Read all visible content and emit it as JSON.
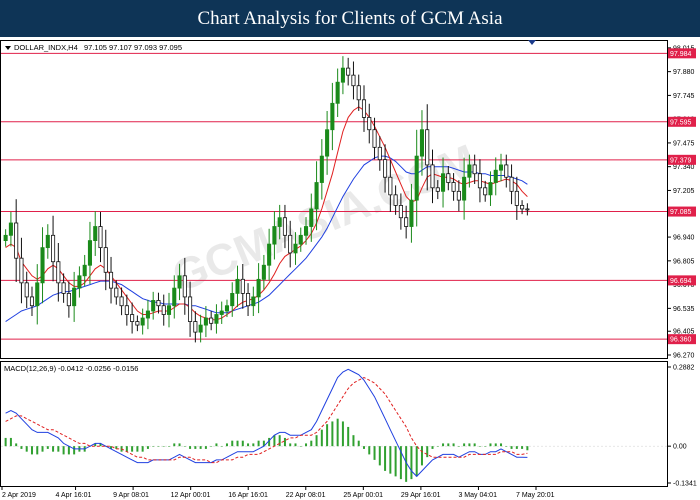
{
  "banner": {
    "title": "Chart Analysis for Clients of GCM Asia"
  },
  "watermark": "GCMASIA.COM",
  "colors": {
    "bull": "#1a8a1a",
    "bear": "#111111",
    "ma_fast": "#e02020",
    "ma_slow": "#2040e0",
    "level": "#e0204a",
    "macd_hist": "#30a030",
    "macd_signal": "#e02020",
    "macd_line": "#2040e0"
  },
  "chart_data": [
    {
      "type": "candlestick",
      "title": "DOLLAR_INDX,H4  97.105 97.107 97.093 97.095",
      "symbol": "DOLLAR_INDX,H4",
      "ohlc_readout": "97.105 97.107 97.093 97.095",
      "ylim": [
        96.27,
        98.02
      ],
      "y_ticks": [
        "98.015",
        "97.880",
        "97.745",
        "97.610",
        "97.475",
        "97.340",
        "97.205",
        "97.070",
        "96.940",
        "96.805",
        "96.670",
        "96.535",
        "96.405",
        "96.270"
      ],
      "x_ticks": [
        "2 Apr 2019",
        "4 Apr 16:01",
        "9 Apr 08:01",
        "12 Apr 00:01",
        "16 Apr 16:01",
        "22 Apr 08:01",
        "25 Apr 00:01",
        "29 Apr 16:01",
        "3 May 04:01",
        "7 May 20:01"
      ],
      "levels": [
        {
          "label": "97.984",
          "value": 97.984
        },
        {
          "label": "97.595",
          "value": 97.595
        },
        {
          "label": "97.379",
          "value": 97.379
        },
        {
          "label": "97.085",
          "value": 97.085
        },
        {
          "label": "96.694",
          "value": 96.694
        },
        {
          "label": "96.360",
          "value": 96.36
        }
      ],
      "series": [
        {
          "kind": "close",
          "values": [
            96.95,
            97.02,
            96.82,
            96.68,
            96.6,
            96.55,
            96.68,
            96.88,
            96.95,
            96.8,
            96.68,
            96.62,
            96.55,
            96.65,
            96.72,
            96.78,
            96.92,
            97.0,
            96.88,
            96.74,
            96.65,
            96.6,
            96.55,
            96.5,
            96.46,
            96.44,
            96.48,
            96.52,
            96.58,
            96.55,
            96.5,
            96.55,
            96.65,
            96.72,
            96.6,
            96.46,
            96.4,
            96.44,
            96.48,
            96.45,
            96.5,
            96.52,
            96.55,
            96.62,
            96.7,
            96.62,
            96.55,
            96.6,
            96.7,
            96.78,
            96.9,
            97.0,
            97.05,
            96.95,
            96.85,
            96.9,
            96.95,
            97.0,
            97.1,
            97.25,
            97.4,
            97.55,
            97.7,
            97.82,
            97.9,
            97.86,
            97.8,
            97.72,
            97.62,
            97.55,
            97.45,
            97.38,
            97.28,
            97.18,
            97.12,
            97.05,
            97.0,
            97.15,
            97.4,
            97.55,
            97.35,
            97.22,
            97.2,
            97.3,
            97.25,
            97.2,
            97.15,
            97.28,
            97.35,
            97.3,
            97.22,
            97.18,
            97.25,
            97.32,
            97.35,
            97.28,
            97.2,
            97.12,
            97.1,
            97.095
          ]
        },
        {
          "kind": "ma_fast",
          "name": "",
          "values": [
            96.88,
            96.9,
            96.88,
            96.8,
            96.76,
            96.72,
            96.7,
            96.72,
            96.76,
            96.78,
            96.76,
            96.72,
            96.68,
            96.66,
            96.66,
            96.68,
            96.72,
            96.76,
            96.78,
            96.76,
            96.72,
            96.68,
            96.64,
            96.6,
            96.56,
            96.52,
            96.5,
            96.5,
            96.51,
            96.52,
            96.52,
            96.52,
            96.54,
            96.56,
            96.56,
            96.54,
            96.51,
            96.49,
            96.48,
            96.47,
            96.47,
            96.48,
            96.5,
            96.52,
            96.55,
            96.57,
            96.58,
            96.59,
            96.61,
            96.64,
            96.68,
            96.73,
            96.79,
            96.83,
            96.85,
            96.87,
            96.89,
            96.92,
            96.96,
            97.02,
            97.1,
            97.2,
            97.3,
            97.42,
            97.54,
            97.62,
            97.66,
            97.68,
            97.66,
            97.62,
            97.57,
            97.51,
            97.45,
            97.38,
            97.31,
            97.24,
            97.17,
            97.14,
            97.15,
            97.22,
            97.28,
            97.3,
            97.29,
            97.28,
            97.28,
            97.27,
            97.25,
            97.24,
            97.25,
            97.26,
            97.26,
            97.25,
            97.24,
            97.25,
            97.26,
            97.27,
            97.26,
            97.24,
            97.2,
            97.17
          ]
        },
        {
          "kind": "ma_slow",
          "name": "",
          "values": [
            96.46,
            96.48,
            96.5,
            96.52,
            96.53,
            96.54,
            96.55,
            96.57,
            96.59,
            96.61,
            96.62,
            96.63,
            96.63,
            96.64,
            96.65,
            96.66,
            96.67,
            96.68,
            96.69,
            96.69,
            96.69,
            96.68,
            96.67,
            96.65,
            96.63,
            96.61,
            96.59,
            96.58,
            96.57,
            96.57,
            96.56,
            96.56,
            96.56,
            96.56,
            96.56,
            96.55,
            96.55,
            96.54,
            96.53,
            96.52,
            96.51,
            96.51,
            96.51,
            96.52,
            96.53,
            96.54,
            96.55,
            96.56,
            96.57,
            96.59,
            96.61,
            96.64,
            96.67,
            96.7,
            96.73,
            96.76,
            96.79,
            96.82,
            96.86,
            96.9,
            96.94,
            96.99,
            97.05,
            97.11,
            97.17,
            97.22,
            97.27,
            97.31,
            97.35,
            97.37,
            97.39,
            97.4,
            97.4,
            97.39,
            97.37,
            97.34,
            97.31,
            97.3,
            97.3,
            97.32,
            97.34,
            97.34,
            97.34,
            97.34,
            97.34,
            97.33,
            97.32,
            97.31,
            97.31,
            97.31,
            97.3,
            97.3,
            97.29,
            97.29,
            97.29,
            97.29,
            97.28,
            97.27,
            97.26,
            97.24
          ]
        }
      ]
    },
    {
      "type": "bar",
      "title": "MACD(12,26,9) -0.0412 -0.0256 -0.0156",
      "indicator": "MACD(12,26,9)",
      "readout": "-0.0412 -0.0256 -0.0156",
      "ylim": [
        -0.1341,
        0.2882
      ],
      "y_ticks": [
        "0.2882",
        "0.00",
        "-0.1341"
      ],
      "series": [
        {
          "kind": "macd_line",
          "name": "",
          "values": [
            0.12,
            0.13,
            0.12,
            0.1,
            0.08,
            0.06,
            0.05,
            0.05,
            0.05,
            0.04,
            0.03,
            0.01,
            0.0,
            -0.01,
            -0.01,
            -0.01,
            0.0,
            0.01,
            0.01,
            0.0,
            -0.01,
            -0.02,
            -0.03,
            -0.04,
            -0.05,
            -0.06,
            -0.06,
            -0.06,
            -0.05,
            -0.05,
            -0.05,
            -0.05,
            -0.04,
            -0.03,
            -0.04,
            -0.05,
            -0.06,
            -0.06,
            -0.06,
            -0.06,
            -0.05,
            -0.05,
            -0.04,
            -0.03,
            -0.02,
            -0.02,
            -0.02,
            -0.02,
            -0.01,
            0.0,
            0.02,
            0.04,
            0.05,
            0.05,
            0.04,
            0.04,
            0.04,
            0.05,
            0.06,
            0.09,
            0.13,
            0.17,
            0.21,
            0.25,
            0.27,
            0.28,
            0.27,
            0.26,
            0.24,
            0.21,
            0.18,
            0.14,
            0.1,
            0.06,
            0.02,
            -0.02,
            -0.06,
            -0.09,
            -0.11,
            -0.09,
            -0.07,
            -0.05,
            -0.04,
            -0.03,
            -0.03,
            -0.03,
            -0.04,
            -0.03,
            -0.02,
            -0.02,
            -0.03,
            -0.03,
            -0.02,
            -0.02,
            -0.01,
            -0.02,
            -0.03,
            -0.04,
            -0.04,
            -0.041
          ]
        },
        {
          "kind": "macd_signal",
          "name": "",
          "values": [
            0.09,
            0.1,
            0.11,
            0.11,
            0.1,
            0.09,
            0.08,
            0.07,
            0.06,
            0.06,
            0.05,
            0.04,
            0.03,
            0.02,
            0.01,
            0.01,
            0.0,
            0.0,
            0.0,
            0.0,
            0.0,
            -0.01,
            -0.01,
            -0.02,
            -0.03,
            -0.04,
            -0.04,
            -0.05,
            -0.05,
            -0.05,
            -0.05,
            -0.05,
            -0.05,
            -0.04,
            -0.04,
            -0.04,
            -0.05,
            -0.05,
            -0.05,
            -0.06,
            -0.06,
            -0.05,
            -0.05,
            -0.05,
            -0.04,
            -0.04,
            -0.03,
            -0.03,
            -0.03,
            -0.02,
            -0.01,
            0.0,
            0.01,
            0.02,
            0.03,
            0.03,
            0.04,
            0.04,
            0.04,
            0.05,
            0.07,
            0.09,
            0.12,
            0.15,
            0.18,
            0.21,
            0.23,
            0.24,
            0.25,
            0.24,
            0.23,
            0.21,
            0.19,
            0.16,
            0.13,
            0.1,
            0.07,
            0.03,
            0.0,
            -0.02,
            -0.03,
            -0.04,
            -0.04,
            -0.04,
            -0.04,
            -0.04,
            -0.04,
            -0.04,
            -0.03,
            -0.03,
            -0.03,
            -0.03,
            -0.03,
            -0.03,
            -0.02,
            -0.02,
            -0.02,
            -0.03,
            -0.03,
            -0.026
          ]
        }
      ]
    }
  ]
}
